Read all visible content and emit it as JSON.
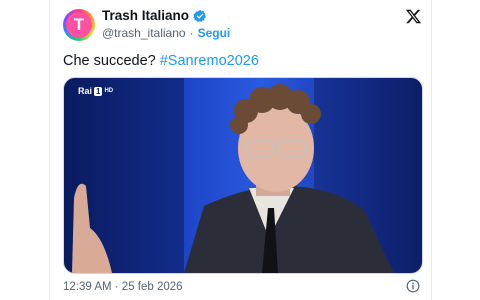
{
  "tweet": {
    "display_name": "Trash Italiano",
    "handle": "@trash_italiano",
    "separator": "·",
    "follow_label": "Segui",
    "text_prefix": "Che succede? ",
    "hashtag": "#Sanremo2026",
    "timestamp": "12:39 AM · 25 feb 2026",
    "avatar_letter": "T"
  },
  "media": {
    "broadcaster": "Rai",
    "channel_badge": "1",
    "hd_label": "HD"
  },
  "colors": {
    "text": "#0f1419",
    "secondary": "#536471",
    "link": "#1d9bf0"
  }
}
